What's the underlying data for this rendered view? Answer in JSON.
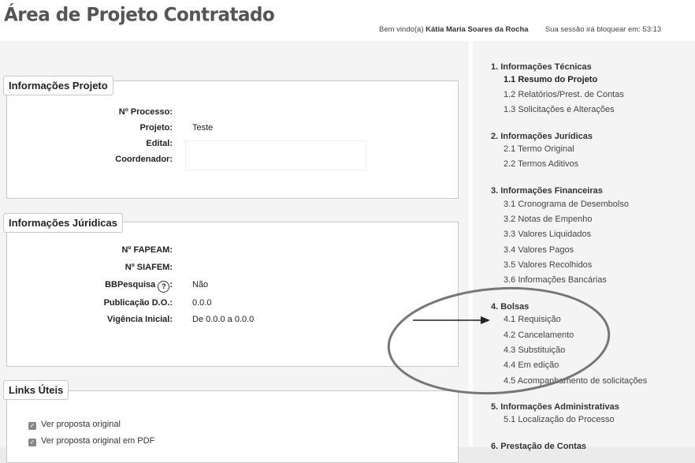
{
  "header": {
    "title": "Área de Projeto Contratado",
    "welcome_prefix": "Bem vindo(a)",
    "user_name": "Kátia Maria Soares da Rocha",
    "session_text": "Sua sessão irá bloquear em: 53:13"
  },
  "project_info": {
    "legend": "Informações Projeto",
    "fields": [
      {
        "label": "Nº Processo:",
        "value": ""
      },
      {
        "label": "Projeto:",
        "value": "Teste"
      },
      {
        "label": "Edital:",
        "value": ""
      },
      {
        "label": "Coordenador:",
        "value": ""
      }
    ]
  },
  "legal_info": {
    "legend": "Informações Júridicas",
    "fields": [
      {
        "label": "Nº FAPEAM:",
        "value": ""
      },
      {
        "label": "Nº SIAFEM:",
        "value": ""
      },
      {
        "label": "BBPesquisa",
        "value": "Não"
      },
      {
        "label": "Publicação D.O.:",
        "value": "0.0.0"
      },
      {
        "label": "Vigência Inicial:",
        "value": "De 0.0.0 a 0.0.0"
      }
    ],
    "colon": ":"
  },
  "links": {
    "legend": "Links Úteis",
    "items": [
      "Ver proposta original",
      "Ver proposta original em PDF"
    ]
  },
  "menu": {
    "sections": [
      {
        "title": "1. Informações Técnicas",
        "items": [
          "1.1 Resumo do Projeto",
          "1.2 Relatórios/Prest. de Contas",
          "1.3 Solicitações e Alterações"
        ]
      },
      {
        "title": "2. Informações Jurídicas",
        "items": [
          "2.1 Termo Original",
          "2.2 Termos Aditivos"
        ]
      },
      {
        "title": "3. Informações Financeiras",
        "items": [
          "3.1 Cronograma de Desembolso",
          "3.2 Notas de Empenho",
          "3.3 Valores Liquidados",
          "3.4 Valores Pagos",
          "3.5 Valores Recolhidos",
          "3.6 Informações Bancárias"
        ]
      },
      {
        "title": "4. Bolsas",
        "items": [
          "4.1 Requisição",
          "4.2 Cancelamento",
          "4.3 Substituição",
          "4.4 Em edição",
          "4.5 Acompanhamento de solicitações"
        ]
      },
      {
        "title": "5. Informações Administrativas",
        "items": [
          "5.1 Localização do Processo"
        ]
      },
      {
        "title": "6. Prestação de Contas",
        "items": []
      }
    ],
    "active_item": "1.1 Resumo do Projeto"
  },
  "icons": {
    "help": "question-circle-icon",
    "check": "checkbox-checked-icon"
  }
}
